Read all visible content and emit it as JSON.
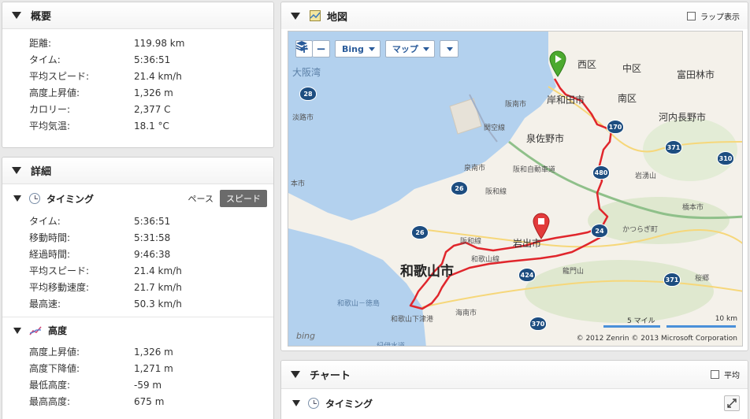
{
  "overview": {
    "title": "概要",
    "stats": [
      {
        "label": "距離:",
        "value": "119.98 km"
      },
      {
        "label": "タイム:",
        "value": "5:36:51"
      },
      {
        "label": "平均スピード:",
        "value": "21.4 km/h"
      },
      {
        "label": "高度上昇値:",
        "value": "1,326 m"
      },
      {
        "label": "カロリー:",
        "value": "2,377 C"
      },
      {
        "label": "平均気温:",
        "value": "18.1 °C"
      }
    ]
  },
  "details": {
    "title": "詳細",
    "timing": {
      "title": "タイミング",
      "pace_label": "ペース",
      "speed_label": "スピード",
      "stats": [
        {
          "label": "タイム:",
          "value": "5:36:51"
        },
        {
          "label": "移動時間:",
          "value": "5:31:58"
        },
        {
          "label": "経過時間:",
          "value": "9:46:38"
        },
        {
          "label": "平均スピード:",
          "value": "21.4 km/h"
        },
        {
          "label": "平均移動速度:",
          "value": "21.7 km/h"
        },
        {
          "label": "最高速:",
          "value": "50.3 km/h"
        }
      ]
    },
    "elevation": {
      "title": "高度",
      "stats": [
        {
          "label": "高度上昇値:",
          "value": "1,326 m"
        },
        {
          "label": "高度下降値:",
          "value": "1,271 m"
        },
        {
          "label": "最低高度:",
          "value": "-59 m"
        },
        {
          "label": "最高高度:",
          "value": "675 m"
        }
      ]
    }
  },
  "map": {
    "title": "地図",
    "lap_checkbox_label": "ラップ表示",
    "zoom_in": "+",
    "zoom_out": "−",
    "provider_button": "Bing",
    "type_button": "マップ",
    "labels": {
      "osaka_bay": "大阪湾",
      "nishi_ku": "西区",
      "naka_ku": "中区",
      "tondabayashi": "富田林市",
      "minami_ku": "南区",
      "kishiwada": "岸和田市",
      "hannan": "阪南市",
      "kawachinagano": "河内長野市",
      "awaji": "淡路市",
      "kansai_airport": "関空線",
      "izumisano": "泉佐野市",
      "sennan": "泉南市",
      "hanwa_expressway": "阪和自動車道",
      "hanwa_line": "阪和線",
      "sumoto": "本市",
      "iwayusan": "岩湧山",
      "hashimoto": "橋本市",
      "katsuragi": "かつらぎ町",
      "iwade": "岩出市",
      "hanwa_line2": "阪和線",
      "wakayama_line": "和歌山線",
      "ryumonzan": "龍門山",
      "wakayama_city": "和歌山市",
      "wakayama_tokushima": "和歌山－徳島",
      "kainan": "海南市",
      "wakayama_shimotsu": "和歌山下津港",
      "kiho": "紀伊水道",
      "kirin": "桜郷"
    },
    "shields": [
      "28",
      "170",
      "371",
      "310",
      "480",
      "26",
      "26",
      "24",
      "424",
      "371",
      "370"
    ],
    "scale_miles": "5 マイル",
    "scale_km": "10 km",
    "copyright": "© 2012 Zenrin   © 2013 Microsoft Corporation",
    "bing_logo": "bing"
  },
  "chart": {
    "title": "チャート",
    "average_label": "平均",
    "timing_title": "タイミング"
  },
  "colors": {
    "route": "#e0262c",
    "start_pin": "#4caa2f",
    "end_pin": "#e23b3b",
    "water": "#b3d1ee",
    "land": "#f4f1ea",
    "accent": "#2a5b9a"
  }
}
